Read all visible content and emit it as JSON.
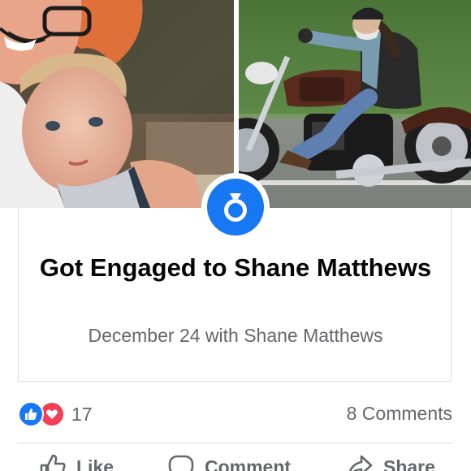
{
  "event": {
    "title": "Got Engaged to Shane Matthews",
    "subtitle": "December 24 with Shane Matthews",
    "icon": "ring-icon",
    "accent": "#1877f2"
  },
  "photos": {
    "left": {
      "subject": "woman-with-child-photo"
    },
    "right": {
      "subject": "man-on-motorcycle-photo"
    }
  },
  "reactions": {
    "icons": [
      "like-reaction-icon",
      "love-reaction-icon"
    ],
    "count": "17",
    "comments": "8 Comments",
    "like_color": "#1877f2",
    "love_color": "#f33e58"
  },
  "actions": {
    "like": "Like",
    "comment": "Comment",
    "share": "Share"
  }
}
